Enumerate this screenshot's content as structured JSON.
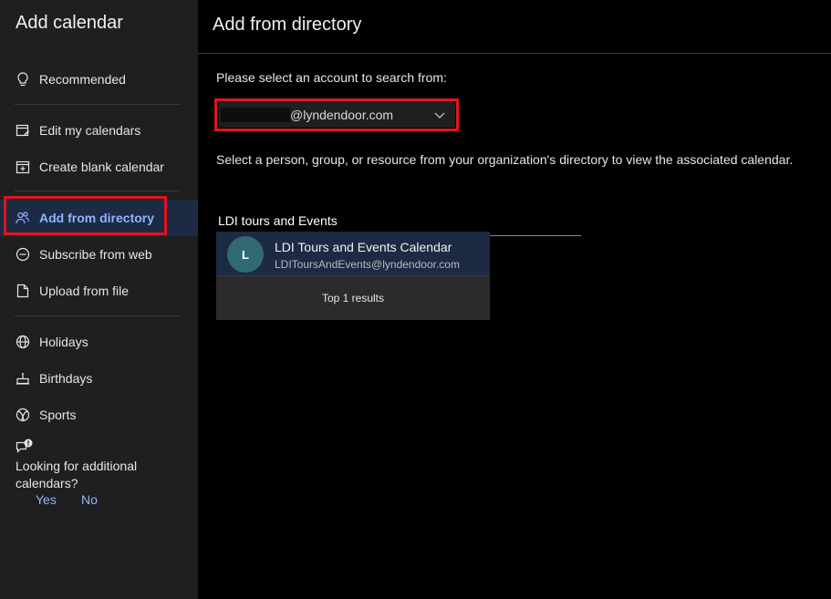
{
  "sidebar": {
    "title": "Add calendar",
    "items": [
      {
        "label": "Recommended",
        "icon": "lightbulb-icon"
      },
      {
        "label": "Edit my calendars",
        "icon": "edit-calendar-icon"
      },
      {
        "label": "Create blank calendar",
        "icon": "add-calendar-icon"
      },
      {
        "label": "Add from directory",
        "icon": "people-icon",
        "selected": true
      },
      {
        "label": "Subscribe from web",
        "icon": "link-icon"
      },
      {
        "label": "Upload from file",
        "icon": "file-upload-icon"
      },
      {
        "label": "Holidays",
        "icon": "globe-icon"
      },
      {
        "label": "Birthdays",
        "icon": "cake-icon"
      },
      {
        "label": "Sports",
        "icon": "ball-icon"
      }
    ],
    "feedback": {
      "question": "Looking for additional calendars?",
      "yes": "Yes",
      "no": "No",
      "icon": "chat-alert-icon"
    }
  },
  "main": {
    "title": "Add from directory",
    "account_prompt": "Please select an account to search from:",
    "account_domain": "@lyndendoor.com",
    "description": "Select a person, group, or resource from your organization's directory to view the associated calendar.",
    "search_value": "LDI tours and Events",
    "results": [
      {
        "initial": "L",
        "name": "LDI Tours and Events Calendar",
        "email": "LDIToursAndEvents@lyndendoor.com"
      }
    ],
    "results_footer": "Top 1 results"
  },
  "colors": {
    "sidebar_bg": "#1f1f1f",
    "selected_bg": "#1c2a44",
    "accent": "#8fb4ff",
    "highlight_red": "#e0141e",
    "avatar_bg": "#2f6a73"
  }
}
